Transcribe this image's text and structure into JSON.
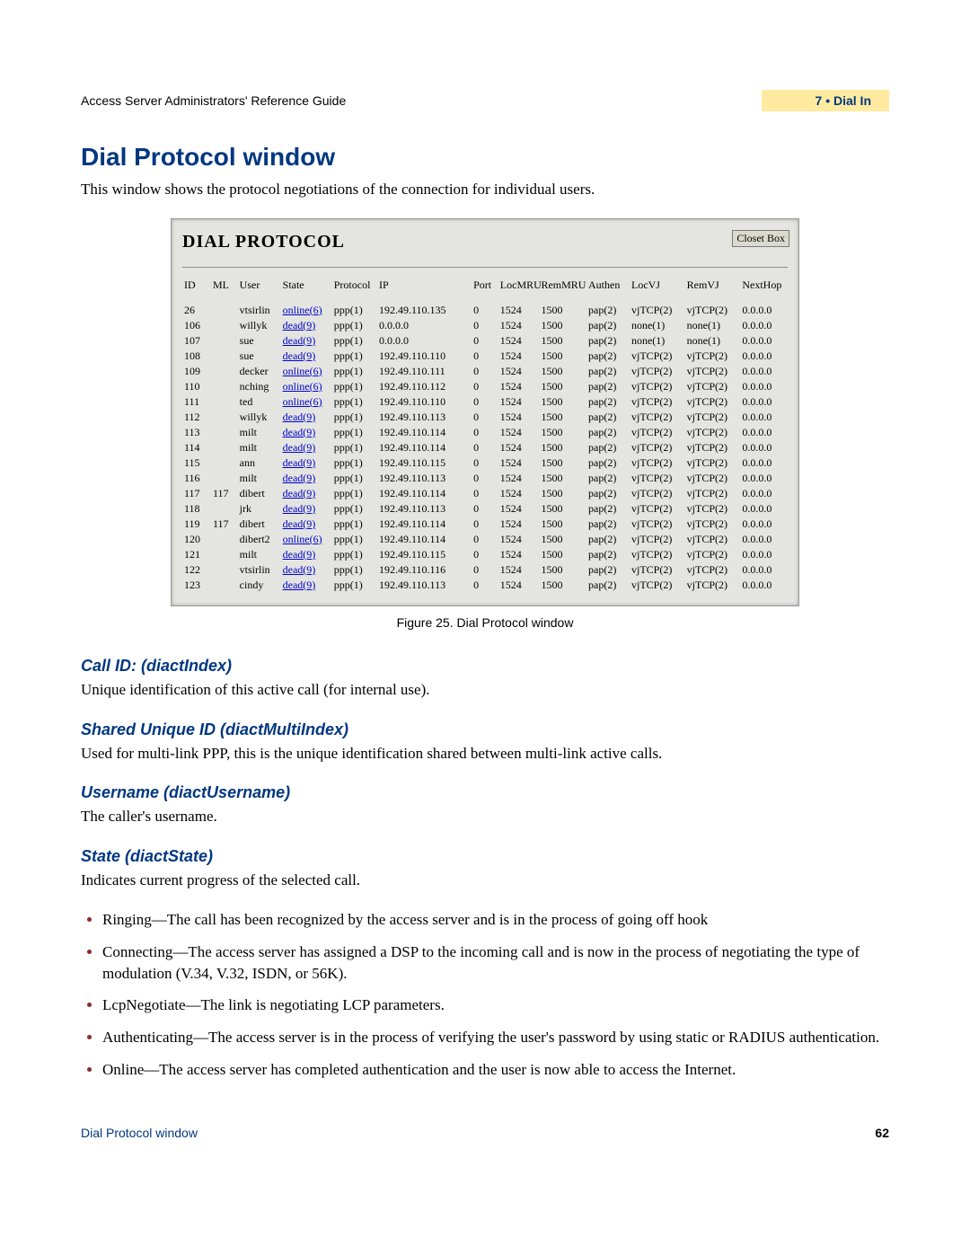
{
  "header": {
    "left": "Access Server Administrators' Reference Guide",
    "right": "7 • Dial In"
  },
  "title": "Dial Protocol window",
  "intro": "This window shows the protocol negotiations of the connection for individual users.",
  "screenshot": {
    "heading": "DIAL PROTOCOL",
    "close_btn": "Closet Box",
    "columns": [
      "ID",
      "ML",
      "User",
      "State",
      "Protocol",
      "IP",
      "Port",
      "LocMRU",
      "RemMRU",
      "Authen",
      "LocVJ",
      "RemVJ",
      "NextHop"
    ],
    "rows": [
      {
        "id": "26",
        "ml": "",
        "user": "vtsirlin",
        "state": "online(6)",
        "proto": "ppp(1)",
        "ip": "192.49.110.135",
        "port": "0",
        "loc": "1524",
        "rem": "1500",
        "auth": "pap(2)",
        "lvj": "vjTCP(2)",
        "rvj": "vjTCP(2)",
        "nh": "0.0.0.0"
      },
      {
        "id": "106",
        "ml": "",
        "user": "willyk",
        "state": "dead(9)",
        "proto": "ppp(1)",
        "ip": "0.0.0.0",
        "port": "0",
        "loc": "1524",
        "rem": "1500",
        "auth": "pap(2)",
        "lvj": "none(1)",
        "rvj": "none(1)",
        "nh": "0.0.0.0"
      },
      {
        "id": "107",
        "ml": "",
        "user": "sue",
        "state": "dead(9)",
        "proto": "ppp(1)",
        "ip": "0.0.0.0",
        "port": "0",
        "loc": "1524",
        "rem": "1500",
        "auth": "pap(2)",
        "lvj": "none(1)",
        "rvj": "none(1)",
        "nh": "0.0.0.0"
      },
      {
        "id": "108",
        "ml": "",
        "user": "sue",
        "state": "dead(9)",
        "proto": "ppp(1)",
        "ip": "192.49.110.110",
        "port": "0",
        "loc": "1524",
        "rem": "1500",
        "auth": "pap(2)",
        "lvj": "vjTCP(2)",
        "rvj": "vjTCP(2)",
        "nh": "0.0.0.0"
      },
      {
        "id": "109",
        "ml": "",
        "user": "decker",
        "state": "online(6)",
        "proto": "ppp(1)",
        "ip": "192.49.110.111",
        "port": "0",
        "loc": "1524",
        "rem": "1500",
        "auth": "pap(2)",
        "lvj": "vjTCP(2)",
        "rvj": "vjTCP(2)",
        "nh": "0.0.0.0"
      },
      {
        "id": "110",
        "ml": "",
        "user": "nching",
        "state": "online(6)",
        "proto": "ppp(1)",
        "ip": "192.49.110.112",
        "port": "0",
        "loc": "1524",
        "rem": "1500",
        "auth": "pap(2)",
        "lvj": "vjTCP(2)",
        "rvj": "vjTCP(2)",
        "nh": "0.0.0.0"
      },
      {
        "id": "111",
        "ml": "",
        "user": "ted",
        "state": "online(6)",
        "proto": "ppp(1)",
        "ip": "192.49.110.110",
        "port": "0",
        "loc": "1524",
        "rem": "1500",
        "auth": "pap(2)",
        "lvj": "vjTCP(2)",
        "rvj": "vjTCP(2)",
        "nh": "0.0.0.0"
      },
      {
        "id": "112",
        "ml": "",
        "user": "willyk",
        "state": "dead(9)",
        "proto": "ppp(1)",
        "ip": "192.49.110.113",
        "port": "0",
        "loc": "1524",
        "rem": "1500",
        "auth": "pap(2)",
        "lvj": "vjTCP(2)",
        "rvj": "vjTCP(2)",
        "nh": "0.0.0.0"
      },
      {
        "id": "113",
        "ml": "",
        "user": "milt",
        "state": "dead(9)",
        "proto": "ppp(1)",
        "ip": "192.49.110.114",
        "port": "0",
        "loc": "1524",
        "rem": "1500",
        "auth": "pap(2)",
        "lvj": "vjTCP(2)",
        "rvj": "vjTCP(2)",
        "nh": "0.0.0.0"
      },
      {
        "id": "114",
        "ml": "",
        "user": "milt",
        "state": "dead(9)",
        "proto": "ppp(1)",
        "ip": "192.49.110.114",
        "port": "0",
        "loc": "1524",
        "rem": "1500",
        "auth": "pap(2)",
        "lvj": "vjTCP(2)",
        "rvj": "vjTCP(2)",
        "nh": "0.0.0.0"
      },
      {
        "id": "115",
        "ml": "",
        "user": "ann",
        "state": "dead(9)",
        "proto": "ppp(1)",
        "ip": "192.49.110.115",
        "port": "0",
        "loc": "1524",
        "rem": "1500",
        "auth": "pap(2)",
        "lvj": "vjTCP(2)",
        "rvj": "vjTCP(2)",
        "nh": "0.0.0.0"
      },
      {
        "id": "116",
        "ml": "",
        "user": "milt",
        "state": "dead(9)",
        "proto": "ppp(1)",
        "ip": "192.49.110.113",
        "port": "0",
        "loc": "1524",
        "rem": "1500",
        "auth": "pap(2)",
        "lvj": "vjTCP(2)",
        "rvj": "vjTCP(2)",
        "nh": "0.0.0.0"
      },
      {
        "id": "117",
        "ml": "117",
        "user": "dibert",
        "state": "dead(9)",
        "proto": "ppp(1)",
        "ip": "192.49.110.114",
        "port": "0",
        "loc": "1524",
        "rem": "1500",
        "auth": "pap(2)",
        "lvj": "vjTCP(2)",
        "rvj": "vjTCP(2)",
        "nh": "0.0.0.0"
      },
      {
        "id": "118",
        "ml": "",
        "user": "jrk",
        "state": "dead(9)",
        "proto": "ppp(1)",
        "ip": "192.49.110.113",
        "port": "0",
        "loc": "1524",
        "rem": "1500",
        "auth": "pap(2)",
        "lvj": "vjTCP(2)",
        "rvj": "vjTCP(2)",
        "nh": "0.0.0.0"
      },
      {
        "id": "119",
        "ml": "117",
        "user": "dibert",
        "state": "dead(9)",
        "proto": "ppp(1)",
        "ip": "192.49.110.114",
        "port": "0",
        "loc": "1524",
        "rem": "1500",
        "auth": "pap(2)",
        "lvj": "vjTCP(2)",
        "rvj": "vjTCP(2)",
        "nh": "0.0.0.0"
      },
      {
        "id": "120",
        "ml": "",
        "user": "dibert2",
        "state": "online(6)",
        "proto": "ppp(1)",
        "ip": "192.49.110.114",
        "port": "0",
        "loc": "1524",
        "rem": "1500",
        "auth": "pap(2)",
        "lvj": "vjTCP(2)",
        "rvj": "vjTCP(2)",
        "nh": "0.0.0.0"
      },
      {
        "id": "121",
        "ml": "",
        "user": "milt",
        "state": "dead(9)",
        "proto": "ppp(1)",
        "ip": "192.49.110.115",
        "port": "0",
        "loc": "1524",
        "rem": "1500",
        "auth": "pap(2)",
        "lvj": "vjTCP(2)",
        "rvj": "vjTCP(2)",
        "nh": "0.0.0.0"
      },
      {
        "id": "122",
        "ml": "",
        "user": "vtsirlin",
        "state": "dead(9)",
        "proto": "ppp(1)",
        "ip": "192.49.110.116",
        "port": "0",
        "loc": "1524",
        "rem": "1500",
        "auth": "pap(2)",
        "lvj": "vjTCP(2)",
        "rvj": "vjTCP(2)",
        "nh": "0.0.0.0"
      },
      {
        "id": "123",
        "ml": "",
        "user": "cindy",
        "state": "dead(9)",
        "proto": "ppp(1)",
        "ip": "192.49.110.113",
        "port": "0",
        "loc": "1524",
        "rem": "1500",
        "auth": "pap(2)",
        "lvj": "vjTCP(2)",
        "rvj": "vjTCP(2)",
        "nh": "0.0.0.0"
      }
    ]
  },
  "figcaption": "Figure 25. Dial Protocol window",
  "sections": [
    {
      "h": "Call ID: (diactIndex)",
      "p": "Unique identification of this active call (for internal use)."
    },
    {
      "h": "Shared Unique ID (diactMultiIndex)",
      "p": "Used for multi-link PPP, this is the unique identification shared between multi-link active calls."
    },
    {
      "h": "Username (diactUsername)",
      "p": "The caller's username."
    },
    {
      "h": "State (diactState)",
      "p": "Indicates current progress of the selected call."
    }
  ],
  "states": [
    "Ringing—The call has been recognized by the access server and is in the process of going off hook",
    "Connecting—The access server has assigned a DSP to the incoming call and is now in the process of negotiating the type of modulation (V.34, V.32, ISDN, or 56K).",
    "LcpNegotiate—The link is negotiating LCP parameters.",
    "Authenticating—The access server is in the process of verifying the user's password by using static or RADIUS authentication.",
    "Online—The access server has completed authentication and the user is now able to access the Internet."
  ],
  "footer": {
    "left": "Dial Protocol window",
    "right": "62"
  }
}
